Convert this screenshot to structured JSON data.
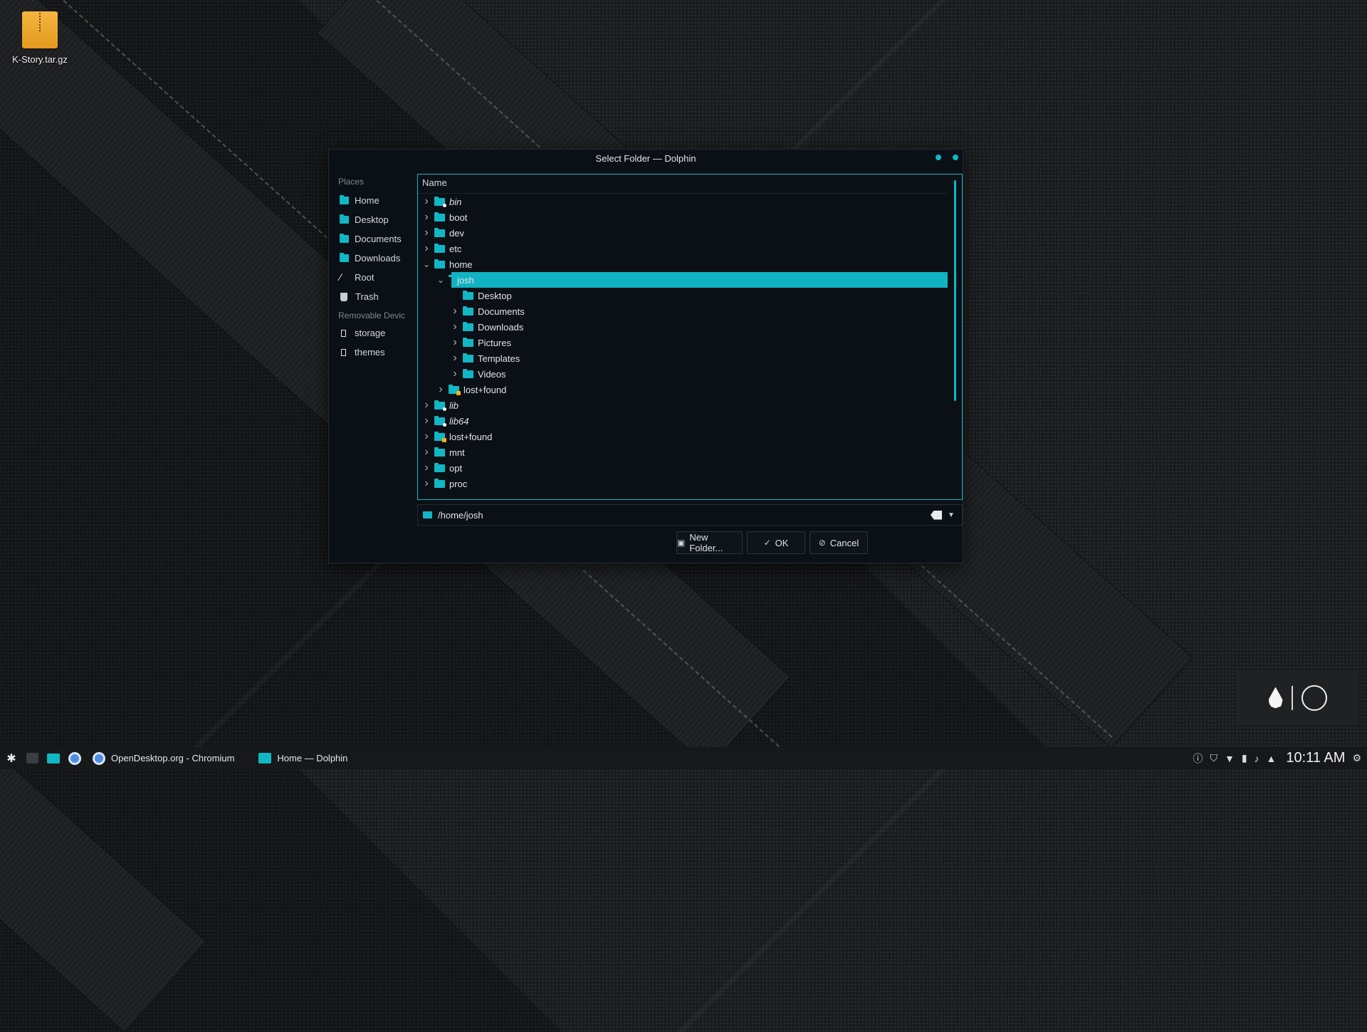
{
  "desktop": {
    "icon_label": "K-Story.tar.gz"
  },
  "dialog": {
    "title": "Select Folder — Dolphin",
    "places_heading": "Places",
    "places": [
      {
        "label": "Home",
        "icon": "folder-home-icon"
      },
      {
        "label": "Desktop",
        "icon": "folder-desktop-icon"
      },
      {
        "label": "Documents",
        "icon": "folder-documents-icon"
      },
      {
        "label": "Downloads",
        "icon": "folder-downloads-icon"
      },
      {
        "label": "Root",
        "icon": "root-slash-icon"
      },
      {
        "label": "Trash",
        "icon": "trash-icon"
      }
    ],
    "removable_heading": "Removable Devic",
    "removable": [
      {
        "label": "storage",
        "icon": "usb-drive-icon"
      },
      {
        "label": "themes",
        "icon": "usb-drive-icon"
      }
    ],
    "tree_header": "Name",
    "tree": [
      {
        "label": "bin",
        "depth": 0,
        "expander": "closed",
        "italic": true,
        "badge": "link"
      },
      {
        "label": "boot",
        "depth": 0,
        "expander": "closed"
      },
      {
        "label": "dev",
        "depth": 0,
        "expander": "closed"
      },
      {
        "label": "etc",
        "depth": 0,
        "expander": "closed"
      },
      {
        "label": "home",
        "depth": 0,
        "expander": "open"
      },
      {
        "label": "josh",
        "depth": 1,
        "expander": "open",
        "selected": true
      },
      {
        "label": "Desktop",
        "depth": 2,
        "expander": "none"
      },
      {
        "label": "Documents",
        "depth": 2,
        "expander": "closed"
      },
      {
        "label": "Downloads",
        "depth": 2,
        "expander": "closed"
      },
      {
        "label": "Pictures",
        "depth": 2,
        "expander": "closed"
      },
      {
        "label": "Templates",
        "depth": 2,
        "expander": "closed"
      },
      {
        "label": "Videos",
        "depth": 2,
        "expander": "closed"
      },
      {
        "label": "lost+found",
        "depth": 1,
        "expander": "closed",
        "badge": "lock"
      },
      {
        "label": "lib",
        "depth": 0,
        "expander": "closed",
        "italic": true,
        "badge": "link"
      },
      {
        "label": "lib64",
        "depth": 0,
        "expander": "closed",
        "italic": true,
        "badge": "link"
      },
      {
        "label": "lost+found",
        "depth": 0,
        "expander": "closed",
        "badge": "lock"
      },
      {
        "label": "mnt",
        "depth": 0,
        "expander": "closed"
      },
      {
        "label": "opt",
        "depth": 0,
        "expander": "closed"
      },
      {
        "label": "proc",
        "depth": 0,
        "expander": "closed"
      }
    ],
    "path_value": "/home/josh",
    "buttons": {
      "new_folder": "New Folder...",
      "ok": "OK",
      "cancel": "Cancel"
    }
  },
  "taskbar": {
    "tasks": [
      {
        "label": "OpenDesktop.org - Chromium",
        "icon": "chromium-icon"
      },
      {
        "label": "Home — Dolphin",
        "icon": "dolphin-folder-icon"
      }
    ],
    "clock": "10:11 AM"
  },
  "colors": {
    "accent": "#11b7c5",
    "dialog_bg": "#0b0f16",
    "taskbar_bg": "#17181a"
  }
}
